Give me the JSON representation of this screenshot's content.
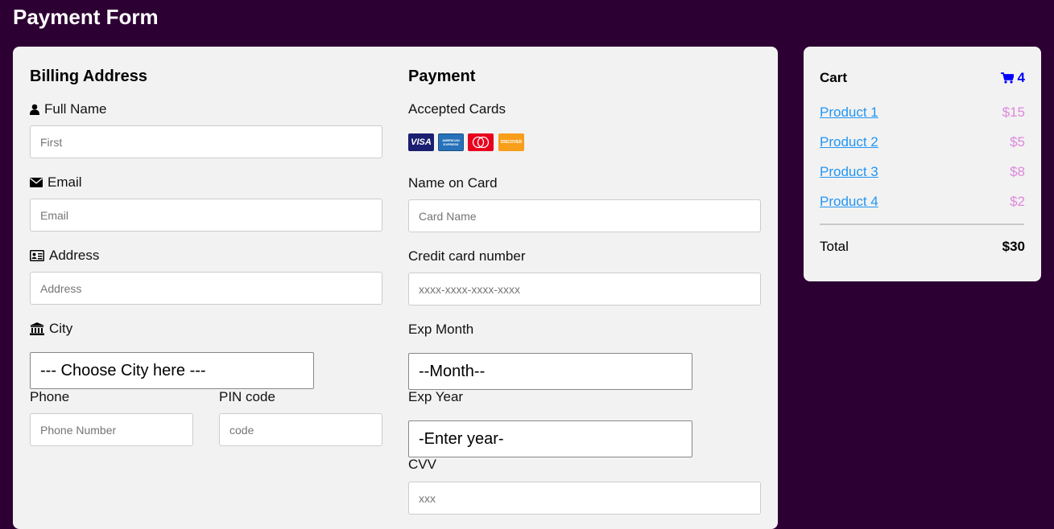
{
  "page": {
    "title": "Payment Form"
  },
  "billing": {
    "heading": "Billing Address",
    "full_name_label": "Full Name",
    "full_name_placeholder": "First",
    "email_label": "Email",
    "email_placeholder": "Email",
    "address_label": "Address",
    "address_placeholder": "Address",
    "city_label": "City",
    "city_select_value": "--- Choose City here ---",
    "phone_label": "Phone",
    "phone_placeholder": "Phone Number",
    "pin_label": "PIN code",
    "pin_placeholder": "code"
  },
  "payment": {
    "heading": "Payment",
    "accepted_cards_label": "Accepted Cards",
    "cards": [
      {
        "name": "visa-icon",
        "text": "VISA",
        "color": "#1a1f71"
      },
      {
        "name": "amex-icon",
        "text": "AMERICAN EXPRESS",
        "color": "#2671b9"
      },
      {
        "name": "mastercard-icon",
        "text": "",
        "color": "#eb001b"
      },
      {
        "name": "discover-icon",
        "text": "DISCOVER",
        "color": "#f79e1b"
      }
    ],
    "name_on_card_label": "Name on Card",
    "name_on_card_placeholder": "Card Name",
    "card_number_label": "Credit card number",
    "card_number_placeholder": "xxxx-xxxx-xxxx-xxxx",
    "exp_month_label": "Exp Month",
    "exp_month_value": "--Month--",
    "exp_year_label": "Exp Year",
    "exp_year_value": "-Enter year-",
    "cvv_label": "CVV",
    "cvv_placeholder": "xxx"
  },
  "cart": {
    "title": "Cart",
    "count": "4",
    "items": [
      {
        "name": "Product 1",
        "price": "$15"
      },
      {
        "name": "Product 2",
        "price": "$5"
      },
      {
        "name": "Product 3",
        "price": "$8"
      },
      {
        "name": "Product 4",
        "price": "$2"
      }
    ],
    "total_label": "Total",
    "total_value": "$30"
  },
  "colors": {
    "background": "#2d0033",
    "card": "#f2f2f2",
    "link": "#2196f3",
    "price": "#dd88dd",
    "cart_icon": "#0000ff"
  }
}
